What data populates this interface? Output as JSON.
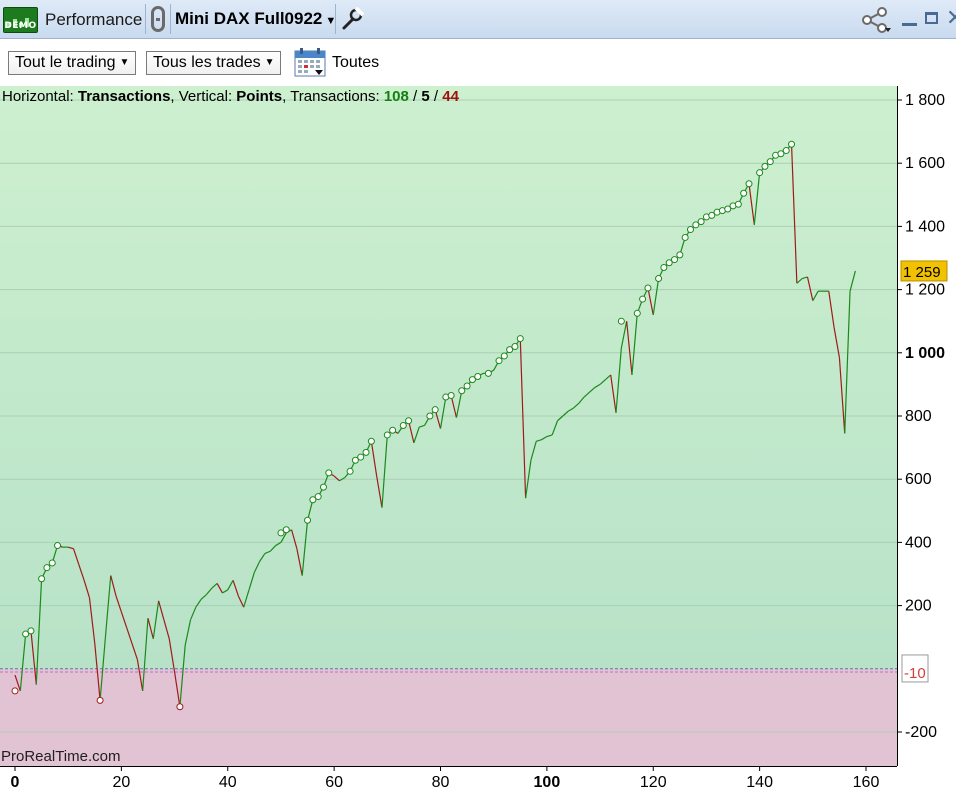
{
  "titlebar": {
    "badge_text": "DEMO",
    "module_title": "Performance",
    "instrument": "Mini DAX Full0922",
    "icons": [
      "demo-badge-icon",
      "link-icon",
      "wrench-icon",
      "share-icon",
      "minimize-icon",
      "maximize-icon",
      "close-icon"
    ]
  },
  "toolbar": {
    "scope_select": "Tout le trading",
    "trades_select": "Tous les trades",
    "period_label": "Toutes",
    "calendar_icon": "calendar-icon"
  },
  "header": {
    "horizontal_prefix": "Horizontal: ",
    "horizontal_value": "Transactions",
    "vertical_prefix": ", Vertical: ",
    "vertical_value": "Points",
    "transactions_prefix": ", Transactions: ",
    "count_winning": "108",
    "slash1": " / ",
    "count_neutral": "5",
    "slash2": " / ",
    "count_losing": "44"
  },
  "watermark": "ProRealTime.com",
  "colors": {
    "gain_area_top": "#cdf0cf",
    "gain_area_bottom": "#b8e2c8",
    "loss_area": "#e1c3d3",
    "up_segment": "#1a8a1a",
    "down_segment": "#a01a1a",
    "zero_line": "#5577aa",
    "current_value_badge": "#f2c200",
    "threshold_label": "#d04040"
  },
  "chart_data": {
    "type": "line",
    "x_axis": {
      "min": 0,
      "max": 160,
      "ticks": [
        0,
        20,
        40,
        60,
        80,
        100,
        120,
        140,
        160
      ],
      "tick_labels": [
        "0",
        "20",
        "40",
        "60",
        "80",
        "100",
        "120",
        "140",
        "160"
      ],
      "bold_ticks": [
        "0",
        "100"
      ]
    },
    "y_axis": {
      "min": -300,
      "max": 1850,
      "ticks": [
        -200,
        200,
        400,
        600,
        800,
        1000,
        1200,
        1400,
        1600,
        1800
      ],
      "tick_labels": [
        "-200",
        "200",
        "400",
        "600",
        "800",
        "1 000",
        "1 200",
        "1 400",
        "1 600",
        "1 800"
      ],
      "bold_ticks": [
        "1 000"
      ]
    },
    "zero_line": 0,
    "threshold_line": -10,
    "threshold_label": "-10",
    "current_value": 1259,
    "current_value_label": "1 259",
    "grid": true,
    "equity_curve": [
      [
        0,
        -20
      ],
      [
        1,
        -70
      ],
      [
        2,
        110
      ],
      [
        3,
        120
      ],
      [
        4,
        -50
      ],
      [
        5,
        285
      ],
      [
        6,
        320
      ],
      [
        7,
        335
      ],
      [
        8,
        390
      ],
      [
        9,
        385
      ],
      [
        10,
        385
      ],
      [
        11,
        380
      ],
      [
        12,
        330
      ],
      [
        13,
        280
      ],
      [
        14,
        225
      ],
      [
        15,
        80
      ],
      [
        16,
        -100
      ],
      [
        17,
        100
      ],
      [
        18,
        295
      ],
      [
        19,
        230
      ],
      [
        20,
        180
      ],
      [
        21,
        130
      ],
      [
        22,
        80
      ],
      [
        23,
        30
      ],
      [
        24,
        -70
      ],
      [
        25,
        160
      ],
      [
        26,
        95
      ],
      [
        27,
        215
      ],
      [
        28,
        155
      ],
      [
        29,
        95
      ],
      [
        30,
        -10
      ],
      [
        31,
        -120
      ],
      [
        32,
        75
      ],
      [
        33,
        155
      ],
      [
        34,
        195
      ],
      [
        35,
        220
      ],
      [
        36,
        235
      ],
      [
        37,
        255
      ],
      [
        38,
        270
      ],
      [
        39,
        240
      ],
      [
        40,
        250
      ],
      [
        41,
        280
      ],
      [
        42,
        230
      ],
      [
        43,
        195
      ],
      [
        44,
        250
      ],
      [
        45,
        305
      ],
      [
        46,
        340
      ],
      [
        47,
        365
      ],
      [
        48,
        372
      ],
      [
        49,
        390
      ],
      [
        50,
        400
      ],
      [
        51,
        430
      ],
      [
        52,
        440
      ],
      [
        53,
        380
      ],
      [
        54,
        295
      ],
      [
        55,
        470
      ],
      [
        56,
        535
      ],
      [
        57,
        545
      ],
      [
        58,
        575
      ],
      [
        59,
        620
      ],
      [
        60,
        610
      ],
      [
        61,
        595
      ],
      [
        62,
        605
      ],
      [
        63,
        625
      ],
      [
        64,
        660
      ],
      [
        65,
        670
      ],
      [
        66,
        685
      ],
      [
        67,
        720
      ],
      [
        68,
        610
      ],
      [
        69,
        510
      ],
      [
        70,
        740
      ],
      [
        71,
        755
      ],
      [
        72,
        745
      ],
      [
        73,
        770
      ],
      [
        74,
        785
      ],
      [
        75,
        715
      ],
      [
        76,
        765
      ],
      [
        77,
        770
      ],
      [
        78,
        800
      ],
      [
        79,
        820
      ],
      [
        80,
        760
      ],
      [
        81,
        860
      ],
      [
        82,
        865
      ],
      [
        83,
        795
      ],
      [
        84,
        880
      ],
      [
        85,
        895
      ],
      [
        86,
        915
      ],
      [
        87,
        925
      ],
      [
        88,
        935
      ],
      [
        89,
        935
      ],
      [
        90,
        945
      ],
      [
        91,
        975
      ],
      [
        92,
        990
      ],
      [
        93,
        1010
      ],
      [
        94,
        1020
      ],
      [
        95,
        1045
      ],
      [
        96,
        540
      ],
      [
        97,
        660
      ],
      [
        98,
        720
      ],
      [
        99,
        725
      ],
      [
        100,
        735
      ],
      [
        101,
        740
      ],
      [
        102,
        785
      ],
      [
        103,
        800
      ],
      [
        104,
        815
      ],
      [
        105,
        825
      ],
      [
        106,
        840
      ],
      [
        107,
        860
      ],
      [
        108,
        875
      ],
      [
        109,
        890
      ],
      [
        110,
        900
      ],
      [
        111,
        915
      ],
      [
        112,
        930
      ],
      [
        113,
        810
      ],
      [
        114,
        1015
      ],
      [
        115,
        1100
      ],
      [
        116,
        930
      ],
      [
        117,
        1125
      ],
      [
        118,
        1170
      ],
      [
        119,
        1205
      ],
      [
        120,
        1120
      ],
      [
        121,
        1235
      ],
      [
        122,
        1270
      ],
      [
        123,
        1285
      ],
      [
        124,
        1295
      ],
      [
        125,
        1310
      ],
      [
        126,
        1365
      ],
      [
        127,
        1390
      ],
      [
        128,
        1405
      ],
      [
        129,
        1415
      ],
      [
        130,
        1430
      ],
      [
        131,
        1435
      ],
      [
        132,
        1445
      ],
      [
        133,
        1450
      ],
      [
        134,
        1455
      ],
      [
        135,
        1465
      ],
      [
        136,
        1470
      ],
      [
        137,
        1505
      ],
      [
        138,
        1535
      ],
      [
        139,
        1405
      ],
      [
        140,
        1570
      ],
      [
        141,
        1590
      ],
      [
        142,
        1605
      ],
      [
        143,
        1625
      ],
      [
        144,
        1630
      ],
      [
        145,
        1640
      ],
      [
        146,
        1660
      ],
      [
        147,
        1220
      ],
      [
        148,
        1235
      ],
      [
        149,
        1240
      ],
      [
        150,
        1165
      ],
      [
        151,
        1195
      ],
      [
        152,
        1195
      ],
      [
        153,
        1195
      ],
      [
        154,
        1080
      ],
      [
        155,
        985
      ],
      [
        156,
        745
      ],
      [
        157,
        1195
      ],
      [
        158,
        1259
      ]
    ],
    "marker_points": [
      [
        0,
        -70
      ],
      [
        2,
        110
      ],
      [
        3,
        120
      ],
      [
        5,
        285
      ],
      [
        6,
        320
      ],
      [
        7,
        335
      ],
      [
        8,
        390
      ],
      [
        16,
        -100
      ],
      [
        31,
        -120
      ],
      [
        50,
        430
      ],
      [
        51,
        440
      ],
      [
        55,
        470
      ],
      [
        56,
        535
      ],
      [
        57,
        545
      ],
      [
        58,
        575
      ],
      [
        59,
        620
      ],
      [
        63,
        625
      ],
      [
        64,
        660
      ],
      [
        65,
        670
      ],
      [
        66,
        685
      ],
      [
        67,
        720
      ],
      [
        70,
        740
      ],
      [
        71,
        755
      ],
      [
        73,
        770
      ],
      [
        74,
        785
      ],
      [
        78,
        800
      ],
      [
        79,
        820
      ],
      [
        81,
        860
      ],
      [
        82,
        865
      ],
      [
        84,
        880
      ],
      [
        85,
        895
      ],
      [
        86,
        915
      ],
      [
        87,
        925
      ],
      [
        89,
        935
      ],
      [
        91,
        975
      ],
      [
        92,
        990
      ],
      [
        93,
        1010
      ],
      [
        94,
        1020
      ],
      [
        95,
        1045
      ],
      [
        114,
        1100
      ],
      [
        117,
        1125
      ],
      [
        118,
        1170
      ],
      [
        119,
        1205
      ],
      [
        121,
        1235
      ],
      [
        122,
        1270
      ],
      [
        123,
        1285
      ],
      [
        124,
        1295
      ],
      [
        125,
        1310
      ],
      [
        126,
        1365
      ],
      [
        127,
        1390
      ],
      [
        128,
        1405
      ],
      [
        129,
        1415
      ],
      [
        130,
        1430
      ],
      [
        131,
        1435
      ],
      [
        132,
        1445
      ],
      [
        133,
        1450
      ],
      [
        134,
        1455
      ],
      [
        135,
        1465
      ],
      [
        136,
        1470
      ],
      [
        137,
        1505
      ],
      [
        138,
        1535
      ],
      [
        140,
        1570
      ],
      [
        141,
        1590
      ],
      [
        142,
        1605
      ],
      [
        143,
        1625
      ],
      [
        144,
        1630
      ],
      [
        145,
        1640
      ],
      [
        146,
        1660
      ]
    ]
  }
}
